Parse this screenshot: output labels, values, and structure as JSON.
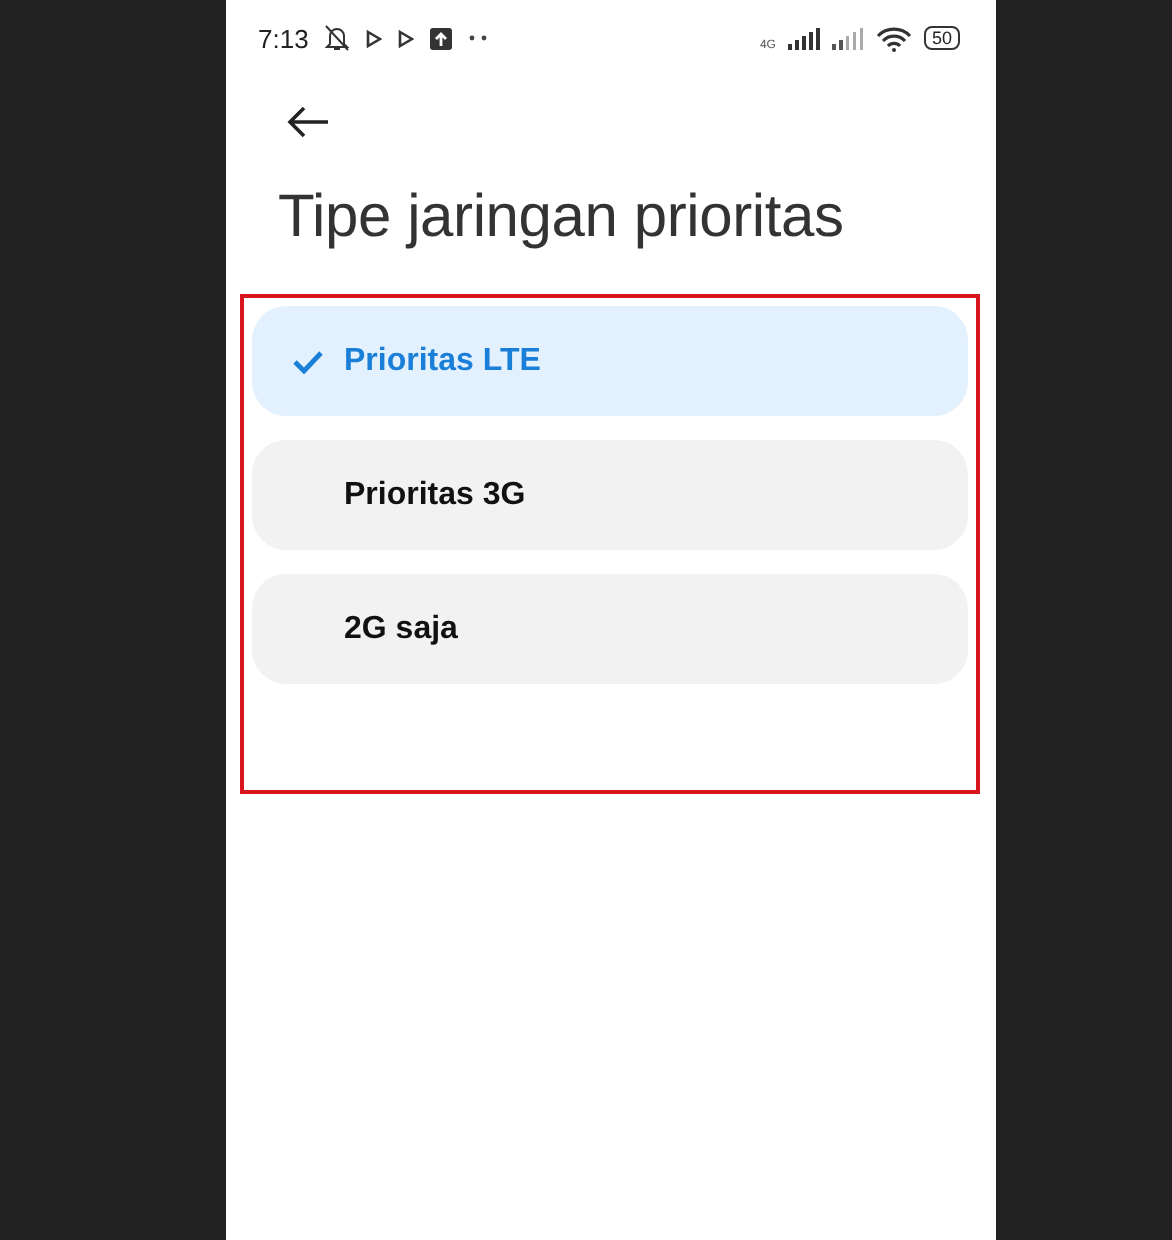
{
  "status_bar": {
    "time": "7:13",
    "network": "4G",
    "battery": "50"
  },
  "title": "Tipe jaringan prioritas",
  "highlight": true,
  "options": [
    {
      "label": "Prioritas LTE",
      "selected": true
    },
    {
      "label": "Prioritas 3G",
      "selected": false
    },
    {
      "label": "2G saja",
      "selected": false
    }
  ]
}
